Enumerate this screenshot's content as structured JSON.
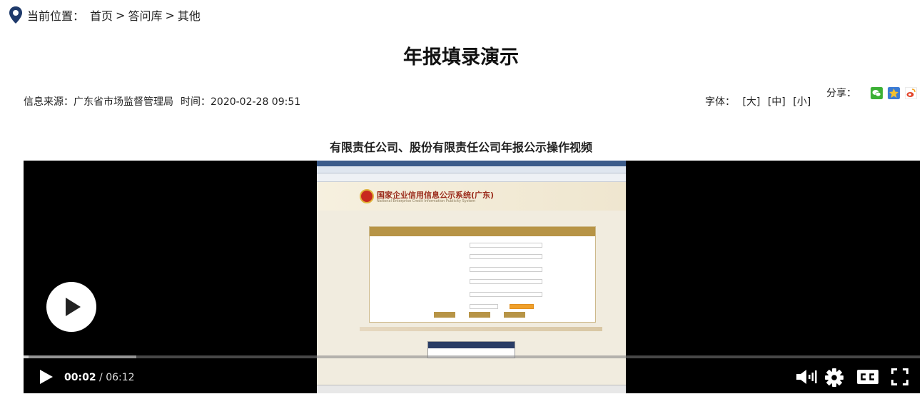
{
  "breadcrumb": {
    "label": "当前位置：",
    "items": [
      "首页",
      "答问库",
      "其他"
    ],
    "separator": ">"
  },
  "article": {
    "title": "年报填录演示",
    "source_label": "信息来源：",
    "source": "广东省市场监督管理局",
    "time_label": "时间：",
    "time": "2020-02-28 09:51"
  },
  "font_size": {
    "label": "字体：",
    "options": [
      "[大]",
      "[中]",
      "[小]"
    ]
  },
  "share": {
    "label": "分享：",
    "icons": [
      "wechat-icon",
      "qzone-icon",
      "weibo-icon"
    ]
  },
  "video": {
    "title": "有限责任公司、股份有限责任公司年报公示操作视频",
    "current_time": "00:02",
    "separator": "/",
    "duration": "06:12",
    "played_fraction": 0.0054,
    "buffered_fraction": 0.126,
    "frame": {
      "site_name": "国家企业信用信息公示系统(广东)",
      "site_sub": "National Enterprise Credit Information Publicity System"
    }
  },
  "colors": {
    "pin": "#1f3a6b",
    "wechat": "#3cb035",
    "qzone": "#f2c02e",
    "weibo": "#e2452c",
    "player_bg": "#000000"
  }
}
